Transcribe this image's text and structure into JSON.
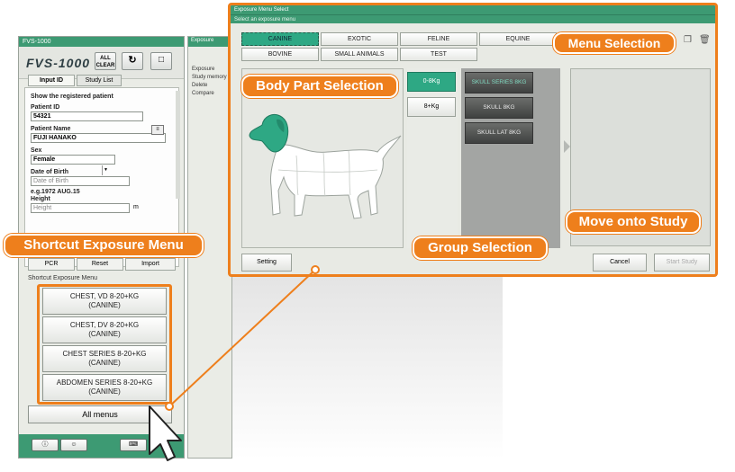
{
  "left_window": {
    "title": "FVS-1000",
    "logo": "FVS-1000",
    "all_clear_label": "ALL CLEAR",
    "refresh_icon": "refresh-icon",
    "monitor_icon": "monitor-icon",
    "tabs": [
      {
        "label": "Input ID"
      },
      {
        "label": "Study List"
      }
    ],
    "patient": {
      "heading": "Show the registered patient",
      "patient_id_label": "Patient ID",
      "patient_id_value": "54321",
      "patient_name_label": "Patient Name",
      "patient_name_value": "FUJI HANAKO",
      "sex_label": "Sex",
      "sex_value": "Female",
      "dob_label": "Date of Birth",
      "dob_placeholder": "Date of Birth",
      "dob_hint": "e.g.1972 AUG.15",
      "height_label": "Height",
      "height_placeholder": "Height",
      "height_unit": "m"
    },
    "sub_tabs": [
      {
        "label": "PCR"
      },
      {
        "label": "Reset"
      },
      {
        "label": "Import"
      }
    ],
    "shortcut_label": "Shortcut Exposure Menu",
    "shortcut_menus": [
      {
        "line1": "CHEST, VD 8-20+KG",
        "line2": "(CANINE)"
      },
      {
        "line1": "CHEST, DV 8-20+KG",
        "line2": "(CANINE)"
      },
      {
        "line1": "CHEST SERIES 8-20+KG",
        "line2": "(CANINE)"
      },
      {
        "line1": "ABDOMEN SERIES 8-20+KG",
        "line2": "(CANINE)"
      }
    ],
    "all_menus_label": "All menus",
    "footer_icons": [
      "info-icon",
      "user-icon",
      "keyboard-icon"
    ]
  },
  "middle_window": {
    "title": "Exposure",
    "rows": [
      "Exposure",
      "Study memory",
      "Delete",
      "Compare"
    ]
  },
  "popup": {
    "title": "Exposure Menu Select",
    "subtitle": "Select an exposure menu",
    "menu_tabs": [
      {
        "label": "CANINE",
        "selected": true
      },
      {
        "label": "EXOTIC",
        "selected": false
      },
      {
        "label": "FELINE",
        "selected": false
      },
      {
        "label": "EQUINE",
        "selected": false
      },
      {
        "label": "BOVINE",
        "selected": false
      },
      {
        "label": "SMALL ANIMALS",
        "selected": false
      },
      {
        "label": "TEST",
        "selected": false
      }
    ],
    "weights": [
      {
        "label": "0-8Kg",
        "selected": true
      },
      {
        "label": "8+Kg",
        "selected": false
      }
    ],
    "groups": [
      {
        "label": "SKULL SERIES 8KG",
        "selected": true
      },
      {
        "label": "SKULL 8KG",
        "selected": false
      },
      {
        "label": "SKULL LAT 8KG",
        "selected": false
      }
    ],
    "setting_label": "Setting",
    "cancel_label": "Cancel",
    "start_study_label": "Start Study",
    "highlight_color": "#2ea884"
  },
  "callouts": {
    "menu_selection": "Menu Selection",
    "body_part_selection": "Body Part Selection",
    "group_selection": "Group Selection",
    "move_onto_study": "Move onto Study",
    "shortcut_exposure_menu": "Shortcut Exposure Menu"
  },
  "colors": {
    "accent_orange": "#ee7f1c",
    "titlebar_green": "#3d9a73"
  }
}
